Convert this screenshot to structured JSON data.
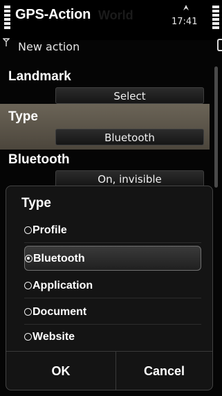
{
  "status_bar": {
    "app_title": "GPS-Action",
    "app_title_ghost": "World",
    "time": "17:41",
    "subtitle": "New action"
  },
  "form": {
    "landmark": {
      "label": "Landmark",
      "value": "Select"
    },
    "type": {
      "label": "Type",
      "value": "Bluetooth"
    },
    "bluetooth": {
      "label": "Bluetooth",
      "value": "On, invisible"
    }
  },
  "popup": {
    "title": "Type",
    "options": [
      {
        "label": "Profile",
        "selected": false
      },
      {
        "label": "Bluetooth",
        "selected": true
      },
      {
        "label": "Application",
        "selected": false
      },
      {
        "label": "Document",
        "selected": false
      },
      {
        "label": "Website",
        "selected": false
      }
    ],
    "ok_label": "OK",
    "cancel_label": "Cancel"
  },
  "colors": {
    "background": "#050505",
    "highlight": "#5c5649",
    "popup_bg": "#141414"
  }
}
